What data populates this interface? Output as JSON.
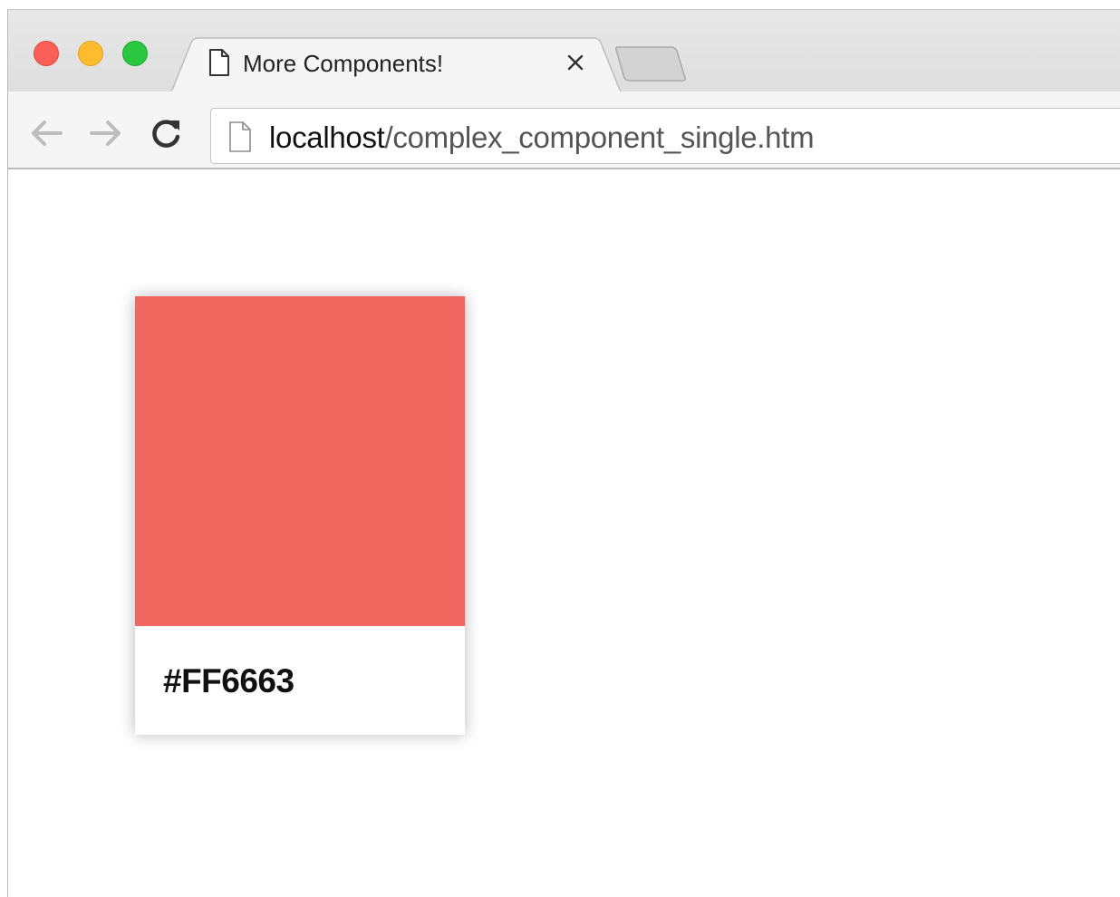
{
  "browser": {
    "tab": {
      "title": "More Components!",
      "icon": "page-icon",
      "close_icon": "close-icon"
    },
    "toolbar": {
      "back_icon": "arrow-left-icon",
      "forward_icon": "arrow-right-icon",
      "reload_icon": "reload-icon"
    },
    "address": {
      "host": "localhost",
      "path": "/complex_component_single.htm",
      "icon": "page-icon"
    }
  },
  "page": {
    "swatch": {
      "color": "#F26660",
      "label": "#FF6663"
    }
  }
}
